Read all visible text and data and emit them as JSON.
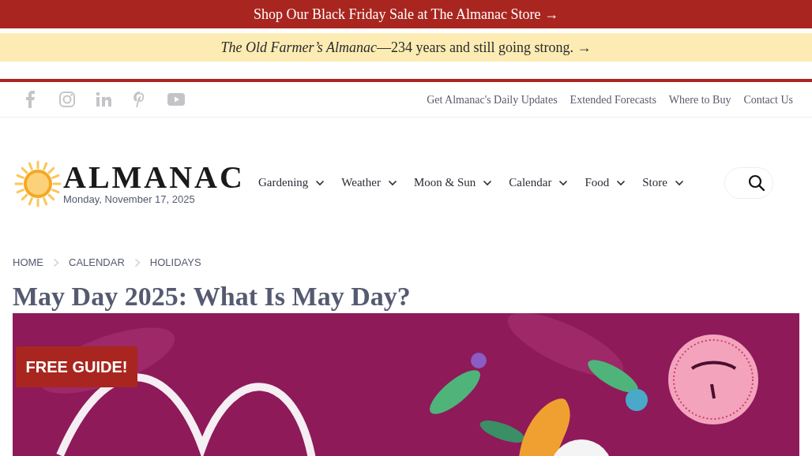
{
  "promo_banner": {
    "text": "Shop Our Black Friday Sale at The Almanac Store →"
  },
  "tagline_banner": {
    "text": "*The Old Farmer’s Almanac*—234 years and still going strong. →"
  },
  "social_links": [
    {
      "kind": "facebook"
    },
    {
      "kind": "instagram"
    },
    {
      "kind": "linkedin"
    },
    {
      "kind": "pinterest"
    },
    {
      "kind": "youtube"
    }
  ],
  "top_links": [
    "Get Almanac's Daily Updates",
    "Extended Forecasts",
    "Where to Buy",
    "Contact Us"
  ],
  "logo": {
    "name": "ALMANAC",
    "date": "Monday, November 17, 2025"
  },
  "nav": [
    {
      "label": "Gardening"
    },
    {
      "label": "Weather"
    },
    {
      "label": "Moon & Sun"
    },
    {
      "label": "Calendar"
    },
    {
      "label": "Food"
    },
    {
      "label": "Store"
    }
  ],
  "breadcrumbs": [
    "HOME",
    "CALENDAR",
    "HOLIDAYS"
  ],
  "title": "May Day 2025: What Is May Day?",
  "hero": {
    "kind": "picture"
  },
  "free_guide_button": "FREE GUIDE!"
}
